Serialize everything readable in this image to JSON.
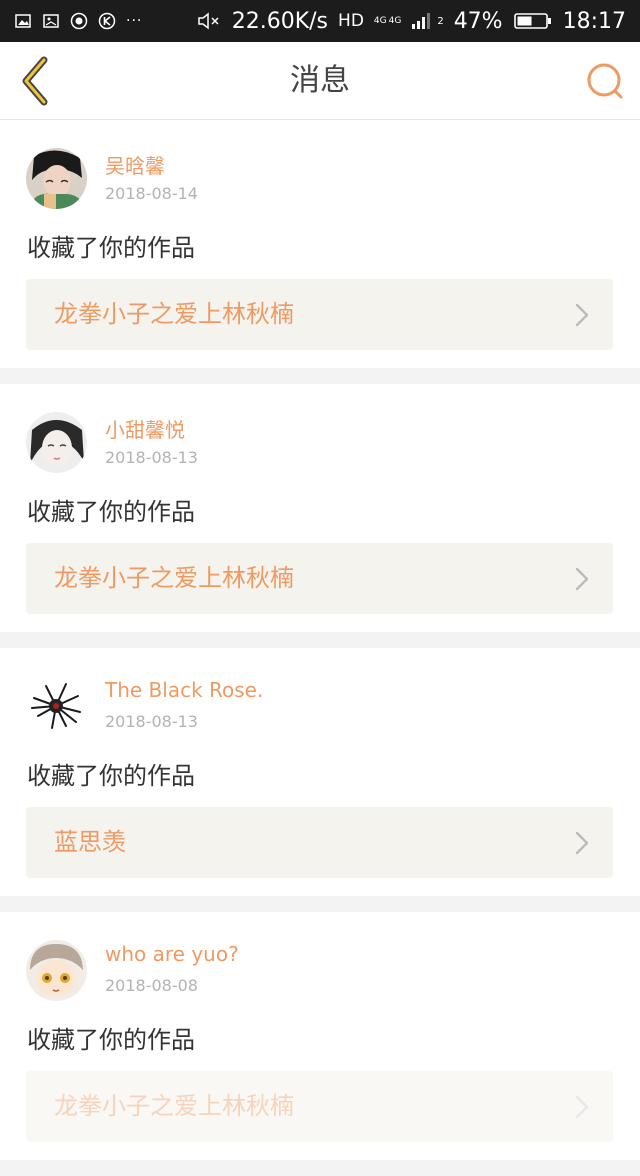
{
  "status_bar": {
    "network_speed": "22.60K/s",
    "hd": "HD",
    "net_type": "4G",
    "net_type2": "4G",
    "sim_slot": "2",
    "battery": "47%",
    "time": "18:17",
    "icons": [
      "image-icon",
      "gallery-icon",
      "record-icon",
      "k-icon",
      "more-dots-icon",
      "mute-icon",
      "signal-icon",
      "battery-icon"
    ]
  },
  "header": {
    "title": "消息",
    "back_icon": "chevron-left-icon",
    "search_icon": "search-icon",
    "accent": "#ee9a62"
  },
  "messages": [
    {
      "username": "吴晗馨",
      "date": "2018-08-14",
      "text": "收藏了你的作品",
      "work_title": "龙拳小子之爱上林秋楠"
    },
    {
      "username": "小甜馨悦",
      "date": "2018-08-13",
      "text": "收藏了你的作品",
      "work_title": "龙拳小子之爱上林秋楠"
    },
    {
      "username": "The Black Rose.",
      "date": "2018-08-13",
      "text": "收藏了你的作品",
      "work_title": "蓝思羡"
    },
    {
      "username": "who are yuo?",
      "date": "2018-08-08",
      "text": "收藏了你的作品",
      "work_title": "龙拳小子之爱上林秋楠"
    }
  ]
}
